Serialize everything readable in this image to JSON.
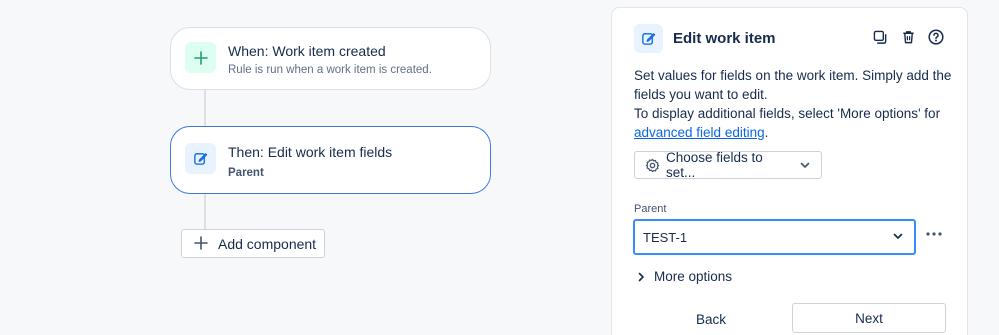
{
  "flow": {
    "trigger": {
      "title": "When: Work item created",
      "subtitle": "Rule is run when a work item is created.",
      "icon": "plus-icon"
    },
    "action": {
      "title": "Then: Edit work item fields",
      "subtitle": "Parent",
      "icon": "edit-icon"
    },
    "add_component_label": "Add component"
  },
  "panel": {
    "title": "Edit work item",
    "description_line1": "Set values for fields on the work item. Simply add the fields you want to edit.",
    "description_line2": "To display additional fields, select 'More options' for ",
    "link_text": "advanced field editing",
    "link_suffix": ".",
    "choose_fields_label": "Choose fields to set...",
    "field_label": "Parent",
    "field_value": "TEST-1",
    "more_options_label": "More options",
    "back_label": "Back",
    "next_label": "Next"
  },
  "colors": {
    "accent": "#388bff",
    "link": "#0c66e4",
    "trigger_icon_bg": "#dcfff1",
    "trigger_icon": "#22a06b",
    "action_icon_bg": "#e9f2ff",
    "action_icon": "#0c66e4"
  }
}
